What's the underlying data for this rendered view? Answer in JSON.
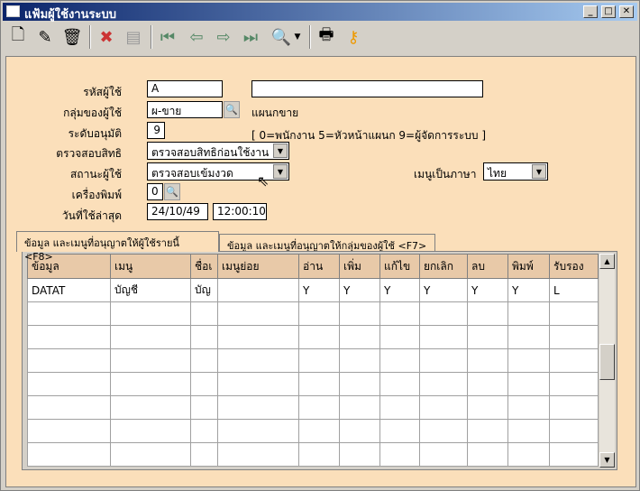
{
  "window": {
    "title": "แฟ้มผู้ใช้งานระบบ",
    "min": "_",
    "max": "□",
    "close": "✕"
  },
  "toolbar": {
    "icons": [
      "new-document-icon",
      "edit-icon",
      "trash-icon",
      "cancel-icon",
      "save-icon",
      "first-record-icon",
      "previous-record-icon",
      "next-record-icon",
      "last-record-icon",
      "search-icon",
      "dropdown-arrow-icon",
      "print-icon",
      "key-icon"
    ]
  },
  "form": {
    "user_code_label": "รหัสผู้ใช้",
    "user_code": "A",
    "user_name": "",
    "group_label": "กลุ่มของผู้ใช้",
    "group": "ผ-ขาย",
    "group_name": "แผนกขาย",
    "level_label": "ระดับอนุมัติ",
    "level": "9",
    "level_hint": "[ 0=พนักงาน  5=หัวหน้าแผนก  9=ผู้จัดการระบบ ]",
    "check_label": "ตรวจสอบสิทธิ",
    "check": "ตรวจสอบสิทธิก่อนใช้งาน",
    "status_label": "สถานะผู้ใช้",
    "status": "ตรวจสอบเข้มงวด",
    "lang_label": "เมนูเป็นภาษา",
    "lang": "ไทย",
    "printer_label": "เครื่องพิมพ์",
    "printer": "0",
    "last_used_label": "วันที่ใช้ล่าสุด",
    "last_date": "24/10/49",
    "last_time": "12:00:10"
  },
  "tabs": [
    {
      "label": "ข้อมูล และเมนูที่อนุญาตให้ผู้ใช้รายนี้  <F8>",
      "active": true
    },
    {
      "label": "ข้อมูล และเมนูที่อนุญาตให้กลุ่มของผู้ใช้  <F7>",
      "active": false
    }
  ],
  "grid": {
    "columns": [
      "ข้อมูล",
      "เมนู",
      "ชื่อเ",
      "เมนูย่อย",
      "อ่าน",
      "เพิ่ม",
      "แก้ไข",
      "ยกเลิก",
      "ลบ",
      "พิมพ์",
      "รับรอง"
    ],
    "rows": [
      [
        "DATAT",
        "บัญชี",
        "บัญ",
        "",
        "Y",
        "Y",
        "Y",
        "Y",
        "Y",
        "Y",
        "L"
      ]
    ],
    "empty_rows": 7
  }
}
